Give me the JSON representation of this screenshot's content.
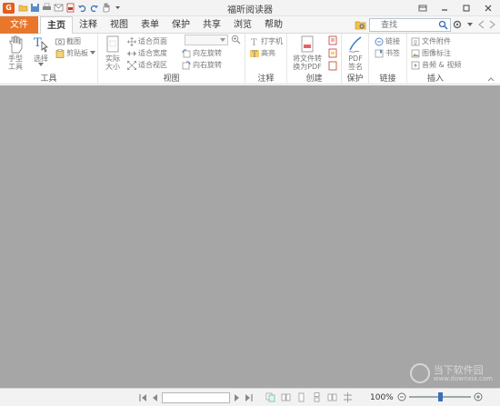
{
  "window": {
    "title": "福昕阅读器",
    "app_icon": "G"
  },
  "ribbon_tabs": {
    "file": "文件",
    "items": [
      "主页",
      "注释",
      "视图",
      "表单",
      "保护",
      "共享",
      "浏览",
      "帮助"
    ],
    "active": "主页"
  },
  "search": {
    "placeholder": "查找"
  },
  "groups": {
    "tools": {
      "label": "工具",
      "hand": "手型\n工具",
      "select": "选择",
      "snapshot": "截图",
      "clipboard": "剪贴板"
    },
    "view": {
      "label": "视图",
      "actual_size": "实际\n大小",
      "fit_page": "适合页面",
      "fit_width": "适合宽度",
      "fit_visible": "适合视区",
      "rotate_left": "向左旋转",
      "rotate_right": "向右旋转"
    },
    "annotate": {
      "label": "注释",
      "typewriter": "打字机",
      "highlight": "高亮"
    },
    "create": {
      "label": "创建",
      "convert": "将文件转\n换为PDF"
    },
    "protect": {
      "label": "保护",
      "sign": "PDF\n签名"
    },
    "links": {
      "label": "链接",
      "link": "链接",
      "bookmark": "书签"
    },
    "insert": {
      "label": "插入",
      "attachment": "文件附件",
      "image": "图像标注",
      "audio_video": "音频 & 视频"
    }
  },
  "status": {
    "zoom": "100%"
  },
  "watermark": {
    "text": "当下软件园",
    "url": "www.downxia.com"
  },
  "colors": {
    "accent": "#e8762b",
    "document_bg": "#a6a6a6"
  }
}
